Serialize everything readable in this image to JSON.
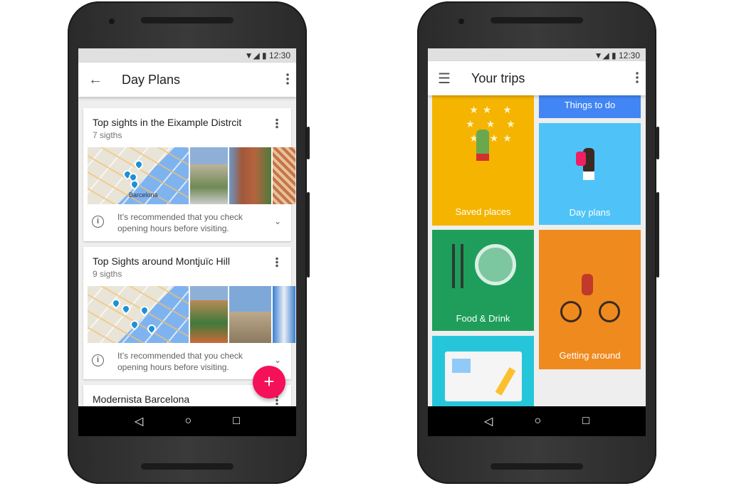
{
  "status_time": "12:30",
  "left": {
    "title": "Day Plans",
    "cards": [
      {
        "title": "Top sights in the Eixample Distrcit",
        "subtitle": "7 sigths",
        "map_label": "Barcelona",
        "info": "It’s recommended that you check opening hours before visiting."
      },
      {
        "title": "Top Sights around Montjuïc Hill",
        "subtitle": "9 sigths",
        "info": "It’s recommended that you check opening hours before visiting."
      },
      {
        "title": "Modernista Barcelona"
      }
    ],
    "fab": "+"
  },
  "right": {
    "title": "Your trips",
    "tiles": {
      "saved": "Saved places",
      "things": "Things to do",
      "day": "Day plans",
      "food": "Food & Drink",
      "getting": "Getting around"
    }
  },
  "nav": {
    "back": "◁",
    "home": "○",
    "recents": "□"
  },
  "colors": {
    "accent": "#f5105a",
    "saved": "#f4b400",
    "things": "#4285f4",
    "day": "#4fc3f7",
    "food": "#1e9e5a",
    "getting": "#ef8a1e",
    "guide": "#26c6da"
  }
}
